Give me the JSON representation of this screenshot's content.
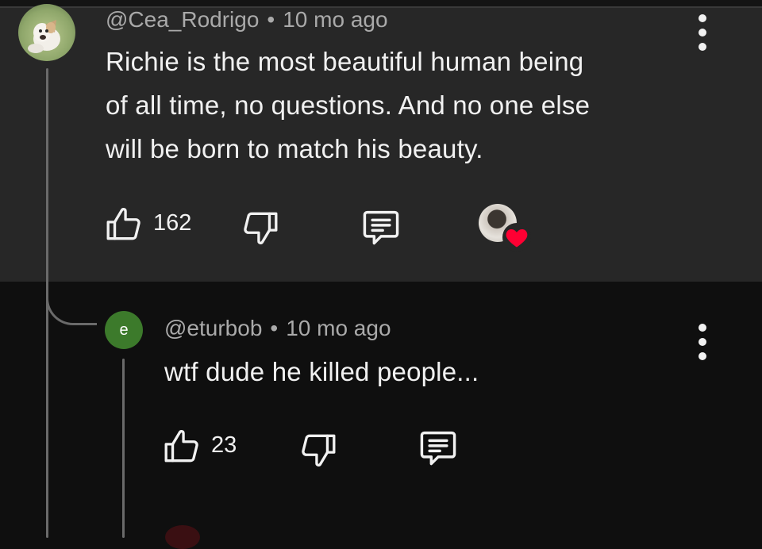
{
  "comment": {
    "author": "@Cea_Rodrigo",
    "time": "10 mo ago",
    "separator": "•",
    "text_lines": [
      "Richie is the most beautiful human being",
      "of all time, no questions. And no one else",
      "will be born to match his beauty."
    ],
    "likes": "162"
  },
  "reply": {
    "avatar_letter": "e",
    "author": "@eturbob",
    "time": "10 mo ago",
    "separator": "•",
    "text": "wtf dude he killed people...",
    "likes": "23"
  },
  "icons": {
    "like": "thumbs-up-icon",
    "dislike": "thumbs-down-icon",
    "reply": "comment-icon",
    "more": "more-vertical-icon",
    "creator_heart": "heart-icon"
  },
  "colors": {
    "highlight_bg": "#272727",
    "page_bg": "#0f0f0f",
    "meta_text": "#aaaaaa",
    "heart": "#ff0033",
    "reply_avatar": "#3c7a2b"
  }
}
